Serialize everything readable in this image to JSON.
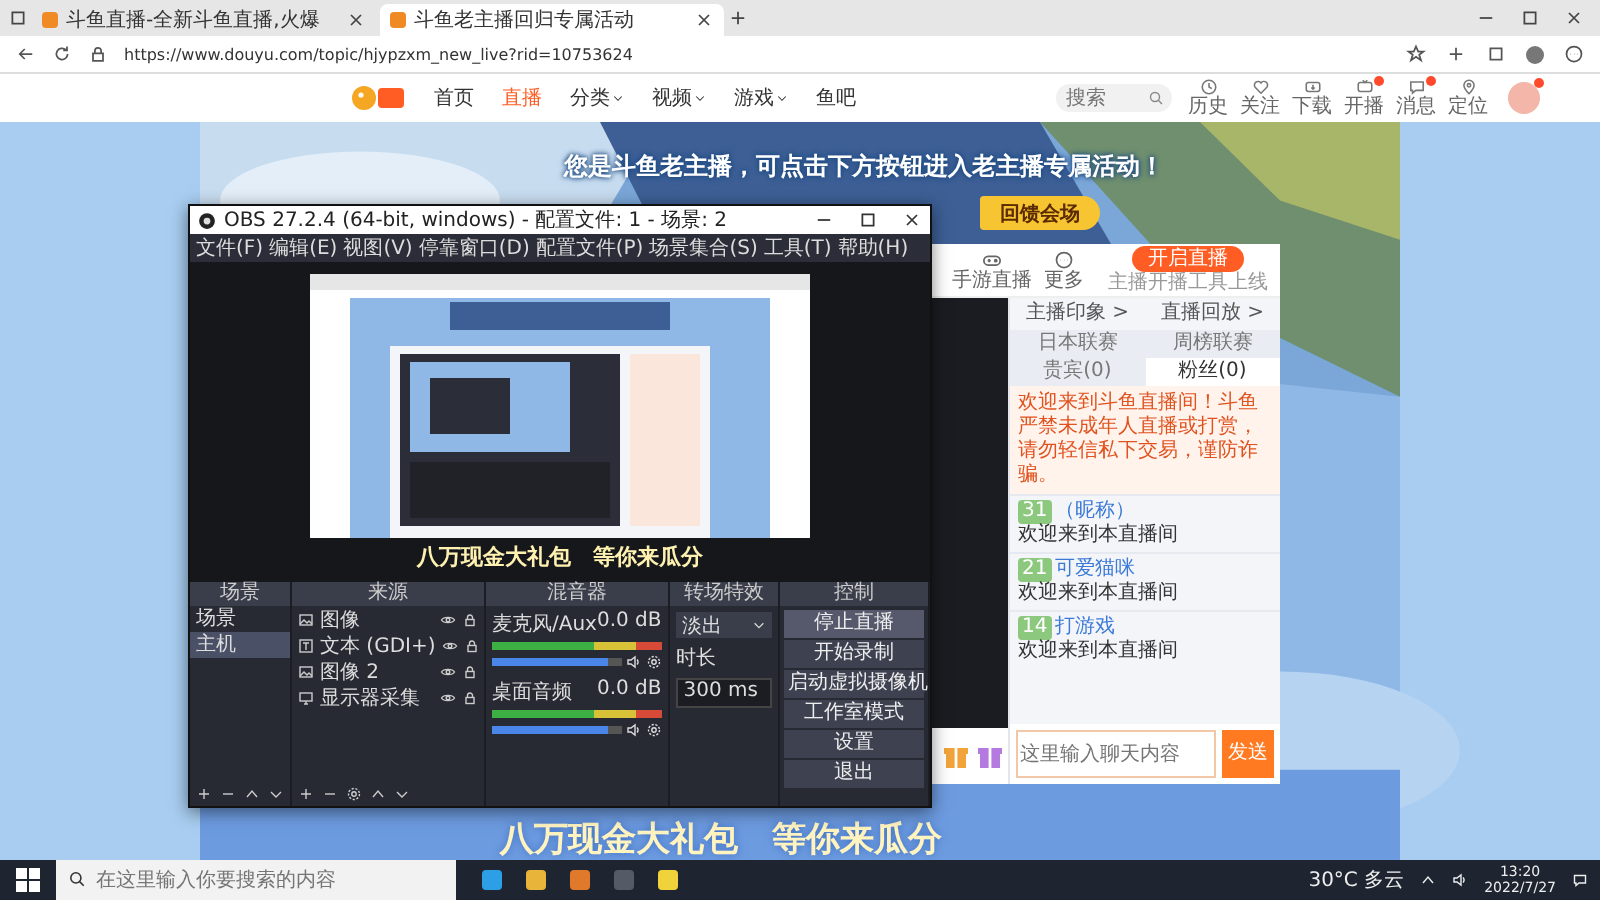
{
  "browser": {
    "tabs": [
      {
        "title": "斗鱼直播-全新斗鱼直播,火爆",
        "selected": false
      },
      {
        "title": "斗鱼老主播回归专属活动",
        "selected": true
      }
    ],
    "url": "https://www.douyu.com/topic/hjypzxm_new_live?rid=10753624"
  },
  "site_header": {
    "nav": [
      {
        "label": "首页",
        "selected": false,
        "dropdown": false
      },
      {
        "label": "直播",
        "selected": true,
        "dropdown": false
      },
      {
        "label": "分类",
        "selected": false,
        "dropdown": true
      },
      {
        "label": "视频",
        "selected": false,
        "dropdown": true
      },
      {
        "label": "游戏",
        "selected": false,
        "dropdown": true
      },
      {
        "label": "鱼吧",
        "selected": false,
        "dropdown": false
      }
    ],
    "search": {
      "placeholder": "搜索"
    },
    "shortcuts": [
      {
        "kind": "history",
        "label": "历史",
        "badge": false
      },
      {
        "kind": "follow",
        "label": "关注",
        "badge": false
      },
      {
        "kind": "download",
        "label": "下载",
        "badge": false
      },
      {
        "kind": "live",
        "label": "开播",
        "badge": true
      },
      {
        "kind": "message",
        "label": "消息",
        "badge": true
      },
      {
        "kind": "location",
        "label": "定位",
        "badge": false
      }
    ],
    "avatar": {
      "badge": true
    }
  },
  "promo": {
    "headline": "您是斗鱼老主播，可点击下方按钮进入老主播专属活动！",
    "button": "回馈会场",
    "banner": "八万现金大礼包　等你来瓜分"
  },
  "room": {
    "tools": [
      {
        "kind": "gamepad",
        "label": "手游直播"
      },
      {
        "kind": "more",
        "label": "更多"
      }
    ],
    "start_button": "开启直播",
    "start_hint": "主播开播工具上线",
    "chat": {
      "links": [
        "主播印象 >",
        "直播回放 >"
      ],
      "tabs": [
        {
          "label": "日本联赛",
          "selected": false
        },
        {
          "label": "周榜联赛",
          "selected": false
        },
        {
          "label": "贵宾(0)",
          "selected": false
        },
        {
          "label": "粉丝(0)",
          "selected": true
        }
      ],
      "notice": "欢迎来到斗鱼直播间！斗鱼严禁未成年人直播或打赏，请勿轻信私下交易，谨防诈骗。",
      "messages": [
        {
          "level": "31",
          "user": "（昵称）",
          "text": "欢迎来到本直播间"
        },
        {
          "level": "21",
          "user": "可爱猫咪",
          "text": "欢迎来到本直播间"
        },
        {
          "level": "14",
          "user": "打游戏",
          "text": "欢迎来到本直播间"
        }
      ],
      "placeholder": "这里输入聊天内容",
      "send": "发送"
    }
  },
  "obs": {
    "title": "OBS 27.2.4 (64-bit, windows) - 配置文件: 1 - 场景: 2",
    "menu": [
      "文件(F)",
      "编辑(E)",
      "视图(V)",
      "停靠窗口(D)",
      "配置文件(P)",
      "场景集合(S)",
      "工具(T)",
      "帮助(H)"
    ],
    "preview_caption": "八万现金大礼包　等你来瓜分",
    "scenes": {
      "title": "场景",
      "items": [
        {
          "label": "场景",
          "selected": false
        },
        {
          "label": "主机",
          "selected": true
        }
      ]
    },
    "sources": {
      "title": "来源",
      "items": [
        {
          "label": "图像"
        },
        {
          "kind": "text",
          "label": "文本 (GDI+)"
        },
        {
          "label": "图像 2"
        },
        {
          "kind": "display",
          "label": "显示器采集"
        }
      ]
    },
    "mixer": {
      "title": "混音器",
      "channels": [
        {
          "name": "麦克风/Aux",
          "reading": "0.0 dB",
          "level": 0.9
        },
        {
          "name": "桌面音频",
          "reading": "0.0 dB",
          "level": 0.9
        }
      ]
    },
    "transitions": {
      "title": "转场特效",
      "type": "淡出",
      "duration_label": "时长",
      "duration": "300 ms"
    },
    "controls": {
      "title": "控制",
      "buttons": [
        "停止直播",
        "开始录制",
        "启动虚拟摄像机",
        "工作室模式",
        "设置",
        "退出"
      ]
    }
  },
  "taskbar": {
    "search_placeholder": "在这里输入你要搜索的内容",
    "weather": "30°C 多云",
    "time": "13:20",
    "date": "2022/7/27"
  }
}
